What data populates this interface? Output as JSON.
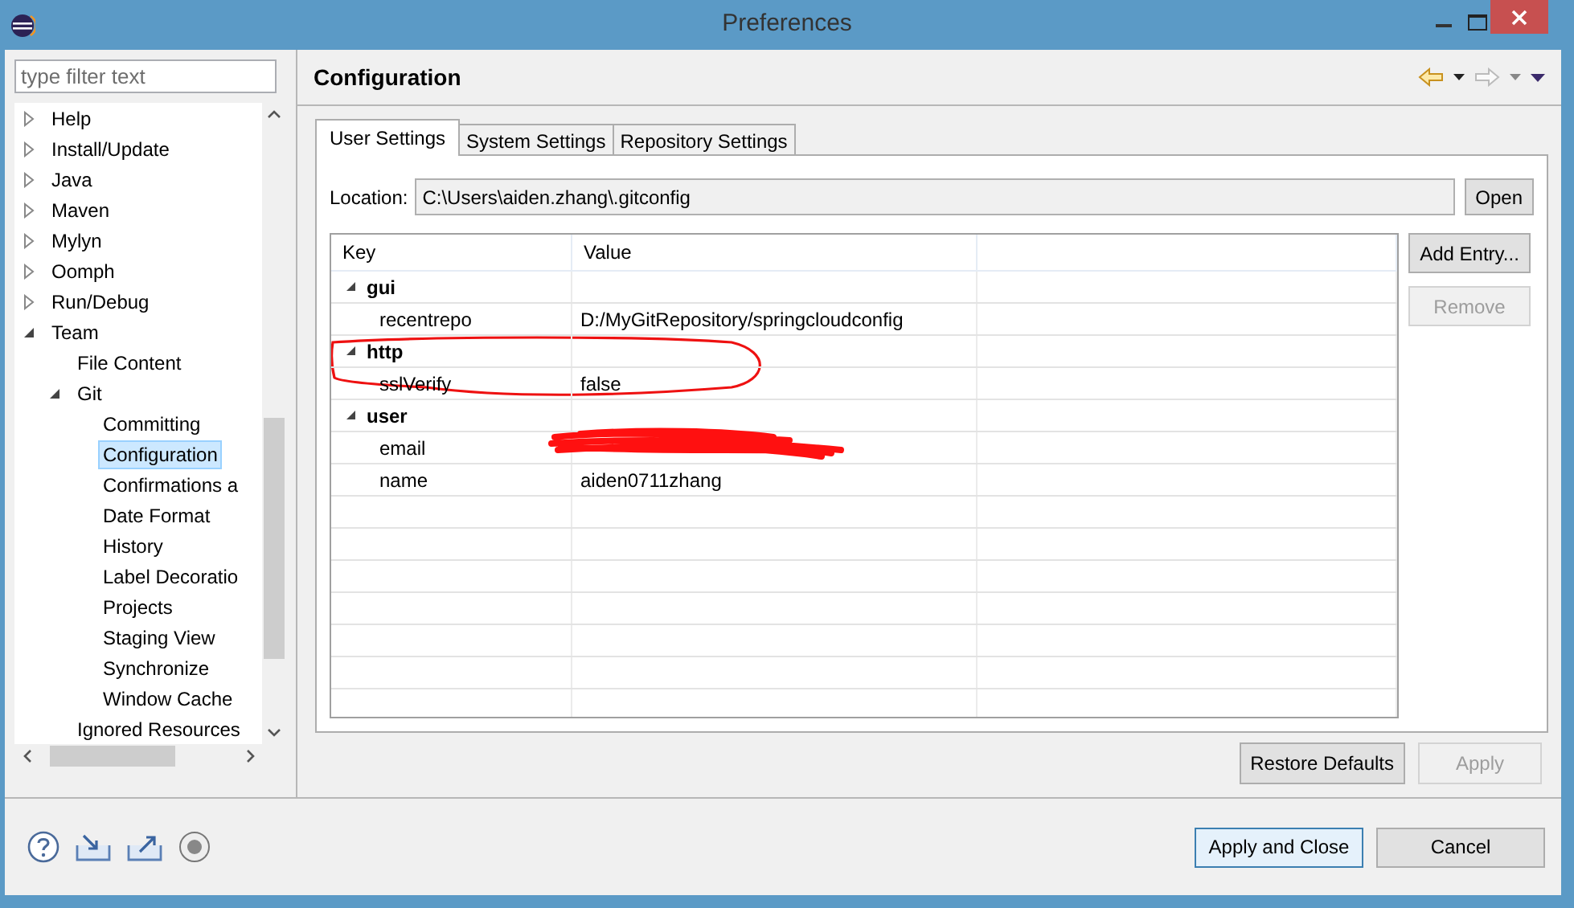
{
  "window": {
    "title": "Preferences"
  },
  "filter": {
    "placeholder": "type filter text"
  },
  "tree": [
    {
      "label": "Help",
      "kind": "group",
      "expanded": false,
      "selected": false
    },
    {
      "label": "Install/Update",
      "kind": "group",
      "expanded": false,
      "selected": false
    },
    {
      "label": "Java",
      "kind": "group",
      "expanded": false,
      "selected": false
    },
    {
      "label": "Maven",
      "kind": "group",
      "expanded": false,
      "selected": false
    },
    {
      "label": "Mylyn",
      "kind": "group",
      "expanded": false,
      "selected": false
    },
    {
      "label": "Oomph",
      "kind": "group",
      "expanded": false,
      "selected": false
    },
    {
      "label": "Run/Debug",
      "kind": "group",
      "expanded": false,
      "selected": false
    },
    {
      "label": "Team",
      "kind": "group",
      "expanded": true,
      "selected": false,
      "children": [
        {
          "label": "File Content",
          "kind": "page",
          "selected": false
        },
        {
          "label": "Git",
          "kind": "group",
          "expanded": true,
          "selected": false,
          "children": [
            {
              "label": "Committing",
              "kind": "page",
              "selected": false
            },
            {
              "label": "Configuration",
              "kind": "page",
              "selected": true
            },
            {
              "label": "Confirmations a",
              "kind": "page",
              "selected": false
            },
            {
              "label": "Date Format",
              "kind": "page",
              "selected": false
            },
            {
              "label": "History",
              "kind": "page",
              "selected": false
            },
            {
              "label": "Label Decoratio",
              "kind": "page",
              "selected": false
            },
            {
              "label": "Projects",
              "kind": "page",
              "selected": false
            },
            {
              "label": "Staging View",
              "kind": "page",
              "selected": false
            },
            {
              "label": "Synchronize",
              "kind": "page",
              "selected": false
            },
            {
              "label": "Window Cache",
              "kind": "page",
              "selected": false
            }
          ]
        },
        {
          "label": "Ignored Resources",
          "kind": "page",
          "selected": false
        }
      ]
    }
  ],
  "page_title": "Configuration",
  "tabs": [
    {
      "label": "User Settings",
      "selected": true
    },
    {
      "label": "System Settings",
      "selected": false
    },
    {
      "label": "Repository Settings",
      "selected": false
    }
  ],
  "location": {
    "label": "Location:",
    "value": "C:\\Users\\aiden.zhang\\.gitconfig",
    "button": "Open"
  },
  "table": {
    "columns": [
      "Key",
      "Value"
    ],
    "sections": [
      {
        "name": "gui",
        "expanded": true,
        "entries": [
          {
            "key": "recentrepo",
            "value": "D:/MyGitRepository/springcloudconfig"
          }
        ]
      },
      {
        "name": "http",
        "expanded": true,
        "entries": [
          {
            "key": "sslVerify",
            "value": "false"
          }
        ]
      },
      {
        "name": "user",
        "expanded": true,
        "entries": [
          {
            "key": "email",
            "redacted": true
          },
          {
            "key": "name",
            "value": "aiden0711zhang"
          }
        ]
      }
    ]
  },
  "side_buttons": [
    {
      "label": "Add Entry...",
      "disabled": false
    },
    {
      "label": "Remove",
      "disabled": true
    }
  ],
  "page_buttons": [
    {
      "label": "Restore Defaults",
      "disabled": false
    },
    {
      "label": "Apply",
      "disabled": true
    }
  ],
  "dialog_buttons": [
    {
      "label": "Apply and Close",
      "default": true
    },
    {
      "label": "Cancel",
      "default": false
    }
  ]
}
